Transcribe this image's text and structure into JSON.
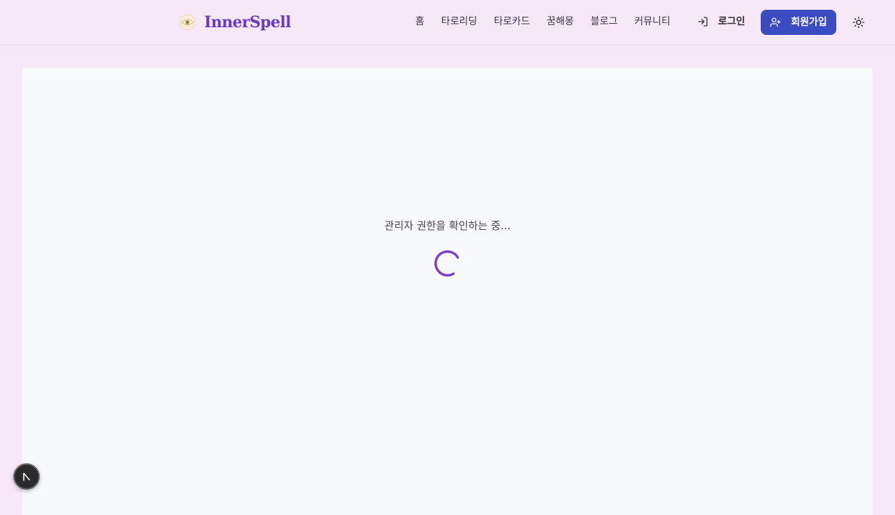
{
  "brand": {
    "name": "InnerSpell",
    "logo_icon": "eye-logo-icon"
  },
  "nav": {
    "items": [
      {
        "label": "홈"
      },
      {
        "label": "타로리딩"
      },
      {
        "label": "타로카드"
      },
      {
        "label": "꿈해몽"
      },
      {
        "label": "블로그"
      },
      {
        "label": "커뮤니티"
      }
    ]
  },
  "auth": {
    "login_label": "로그인",
    "login_icon": "login-icon",
    "signup_label": "회원가입",
    "signup_icon": "user-plus-icon"
  },
  "theme": {
    "toggle_icon": "sun-icon"
  },
  "main": {
    "loading_text": "관리자 권한을 확인하는 중...",
    "spinner_icon": "loading-spinner-icon"
  },
  "colors": {
    "accent": "#6b39c2",
    "primary_button": "#3b4cc0",
    "background": "#f6e8f7",
    "panel": "#f8f9fb"
  }
}
